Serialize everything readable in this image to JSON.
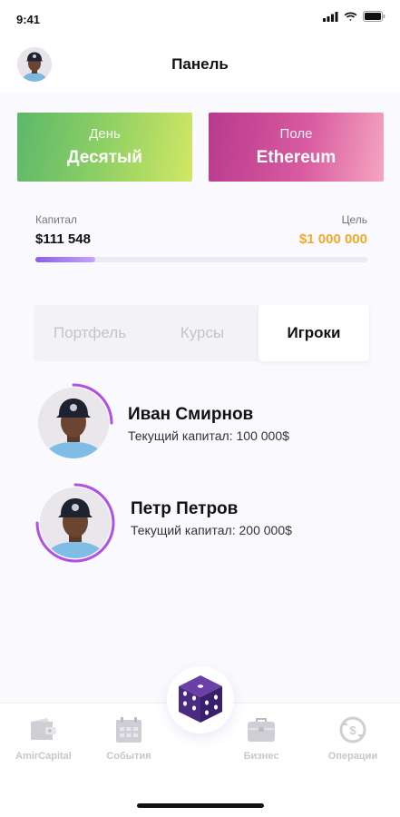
{
  "status_bar": {
    "time": "9:41"
  },
  "header": {
    "title": "Панель"
  },
  "cards": {
    "day": {
      "label": "День",
      "value": "Десятый"
    },
    "field": {
      "label": "Поле",
      "value": "Ethereum"
    }
  },
  "capital": {
    "label": "Капитал",
    "value": "$111 548",
    "goal_label": "Цель",
    "goal_value": "$1 000 000",
    "progress_fraction": 0.18
  },
  "tabs": {
    "portfolio": "Портфель",
    "rates": "Курсы",
    "players": "Игроки",
    "active": "players"
  },
  "players": [
    {
      "name": "Иван Смирнов",
      "capital": "Текущий капитал: 100 000$"
    },
    {
      "name": "Петр Петров",
      "capital": "Текущий капитал: 200 000$"
    }
  ],
  "nav": {
    "amir": "AmirCapital",
    "events": "События",
    "business": "Бизнес",
    "ops": "Операции"
  },
  "colors": {
    "accent": "#9b5cf0",
    "goal": "#f0a92a",
    "dice": "#4a2a82"
  }
}
